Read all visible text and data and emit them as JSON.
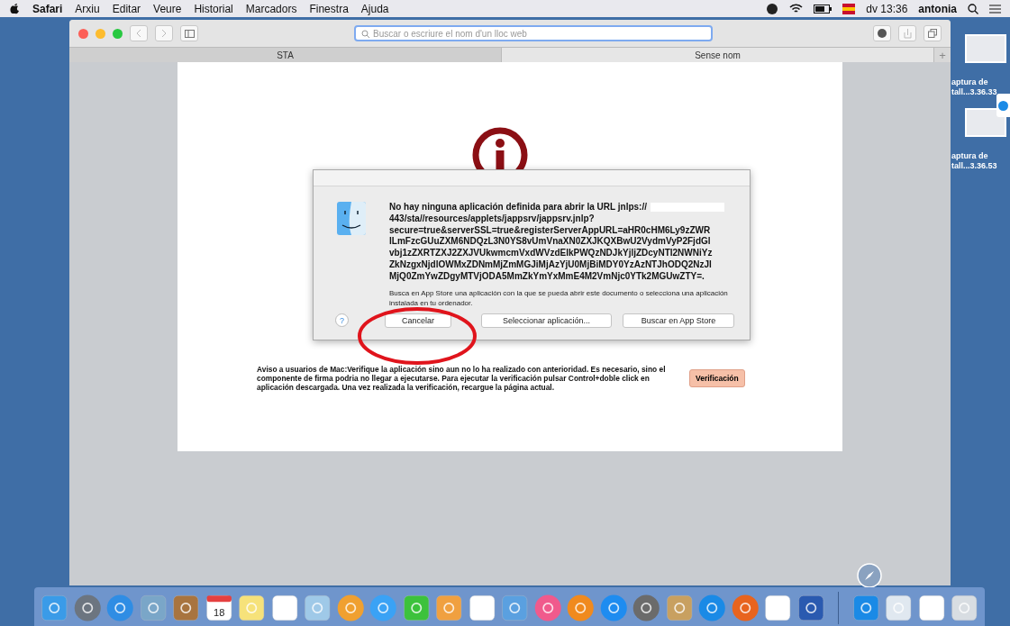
{
  "menu_bar": {
    "app_name": "Safari",
    "items": [
      "Arxiu",
      "Editar",
      "Veure",
      "Historial",
      "Marcadors",
      "Finestra",
      "Ajuda"
    ],
    "clock": "dv 13:36",
    "user": "antonia"
  },
  "browser": {
    "address_placeholder": "Buscar o escriure el nom d'un lloc web",
    "tabs": [
      {
        "label": "STA",
        "selected": true
      },
      {
        "label": "Sense nom",
        "selected": false
      }
    ],
    "new_tab": "+"
  },
  "dialog": {
    "message_lines": [
      "No hay ninguna aplicación definida para abrir la URL jnlps://",
      "443/sta//resources/applets/jappsrv/jappsrv.jnlp?",
      "secure=true&serverSSL=true&registerServerAppURL=aHR0cHM6Ly9zZWR",
      "lLmFzcGUuZXM6NDQzL3N0YS8vUmVnaXN0ZXJKQXBwU2VydmVyP2FjdGl",
      "vbj1zZXRTZXJ2ZXJVUkwmcmVxdWVzdElkPWQzNDJkYjljZDcyNTI2NWNiYz",
      "ZkNzgxNjdlOWMxZDNmMjZmMGJiMjAzYjU0MjBiMDY0YzAzNTJhODQ2NzJl",
      "MjQ0ZmYwZDgyMTVjODA5MmZkYmYxMmE4M2VmNjc0YTk2MGUwZTY=."
    ],
    "hint": "Busca en App Store una aplicación con la que se pueda abrir este documento o selecciona una aplicación instalada en tu ordenador.",
    "help": "?",
    "buttons": [
      "Cancelar",
      "Seleccionar aplicación...",
      "Buscar en App Store"
    ]
  },
  "notice": {
    "text": "Aviso a usuarios de Mac:Verifique la aplicación sino aun no lo ha realizado con anterioridad. Es necesario, sino el componente de firma podria no llegar a ejecutarse. Para ejecutar la verificación pulsar Control+doble click en aplicación descargada. Una vez realizada la verificación, recargue la página actual.",
    "button": "Verificación"
  },
  "desktop_files": [
    {
      "line_1": "aptura de",
      "line_2": "tall...3.36.33"
    },
    {
      "line_1": "aptura de",
      "line_2": "tall...3.36.53"
    }
  ],
  "dock": {
    "calendar_day": "18"
  }
}
